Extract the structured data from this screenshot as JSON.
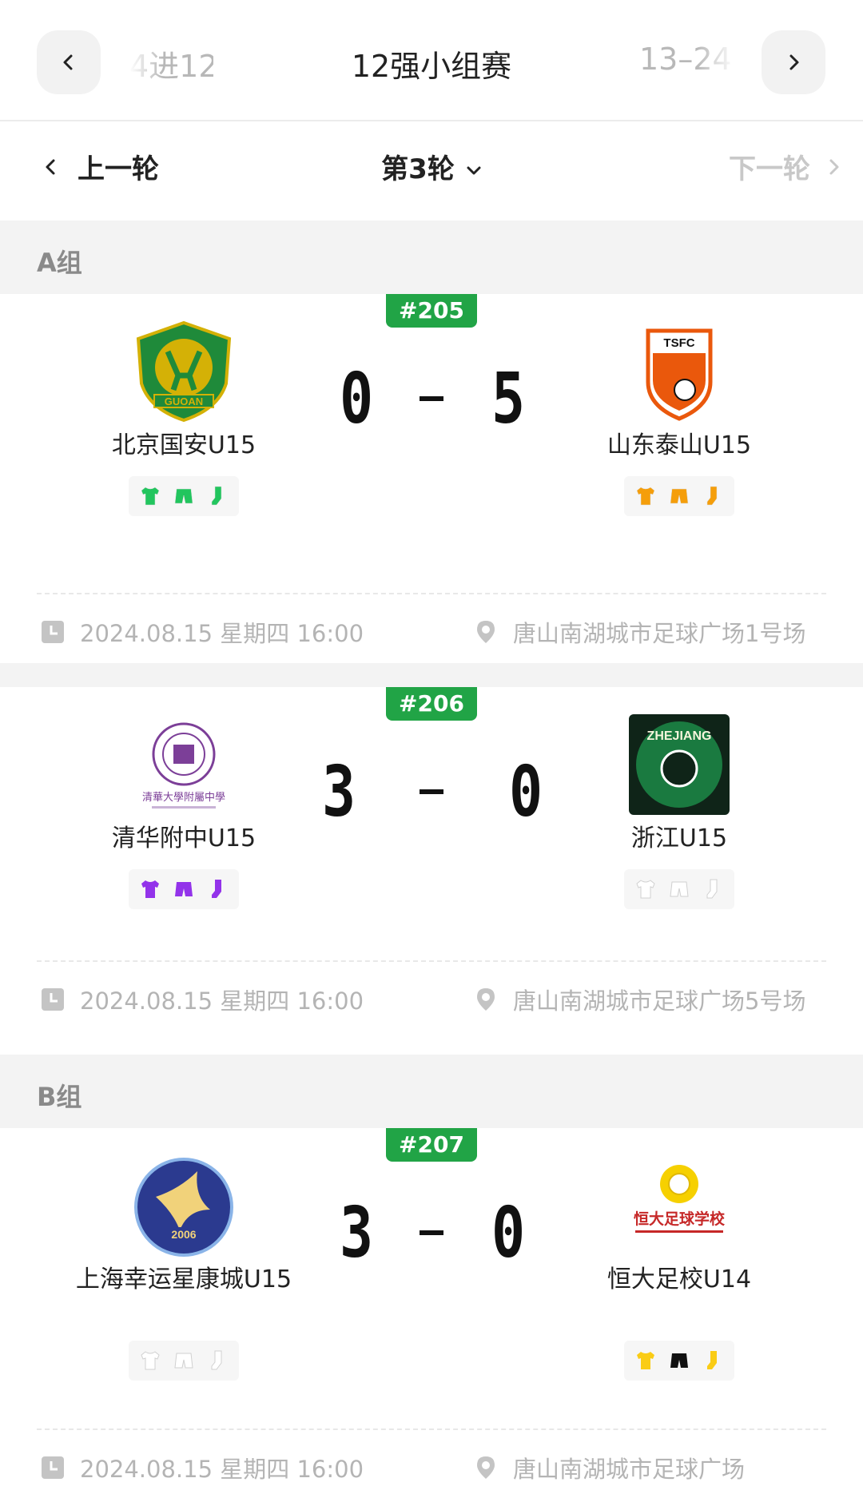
{
  "stage_nav": {
    "prev": "4进12",
    "current": "12强小组赛",
    "next": "13–24"
  },
  "round_nav": {
    "prev": "上一轮",
    "current": "第3轮",
    "next": "下一轮"
  },
  "groups": [
    {
      "name": "A组",
      "matches": [
        {
          "number": "#205",
          "home": {
            "name": "北京国安U15",
            "score": "0",
            "kit_color": "#22c55e",
            "logo_text": "GUOAN"
          },
          "away": {
            "name": "山东泰山U15",
            "score": "5",
            "kit_color": "#f59e0b",
            "logo_text": "TSFC"
          },
          "datetime": "2024.08.15 星期四 16:00",
          "venue": "唐山南湖城市足球广场1号场"
        },
        {
          "number": "#206",
          "home": {
            "name": "清华附中U15",
            "score": "3",
            "kit_color": "#9333ea",
            "logo_text": "清華大學附屬中學"
          },
          "away": {
            "name": "浙江U15",
            "score": "0",
            "kit_color": "#ffffff",
            "logo_text": "ZHEJIANG"
          },
          "datetime": "2024.08.15 星期四 16:00",
          "venue": "唐山南湖城市足球广场5号场"
        }
      ]
    },
    {
      "name": "B组",
      "matches": [
        {
          "number": "#207",
          "home": {
            "name": "上海幸运星康城U15",
            "score": "3",
            "kit_color": "#ffffff",
            "logo_text": "2006"
          },
          "away": {
            "name": "恒大足校U14",
            "score": "0",
            "kit_color": "#facc15",
            "shorts_color": "#111111",
            "logo_text": "恒大足球学校"
          },
          "datetime": "2024.08.15 星期四 16:00",
          "venue": "唐山南湖城市足球广场"
        }
      ]
    }
  ],
  "icons": {
    "stage_prev": "chevron-left-icon",
    "stage_next": "chevron-right-icon",
    "time": "clock-icon",
    "venue": "location-pin-icon"
  },
  "colors": {
    "accent": "#21a446",
    "muted": "#b4b4b4"
  }
}
